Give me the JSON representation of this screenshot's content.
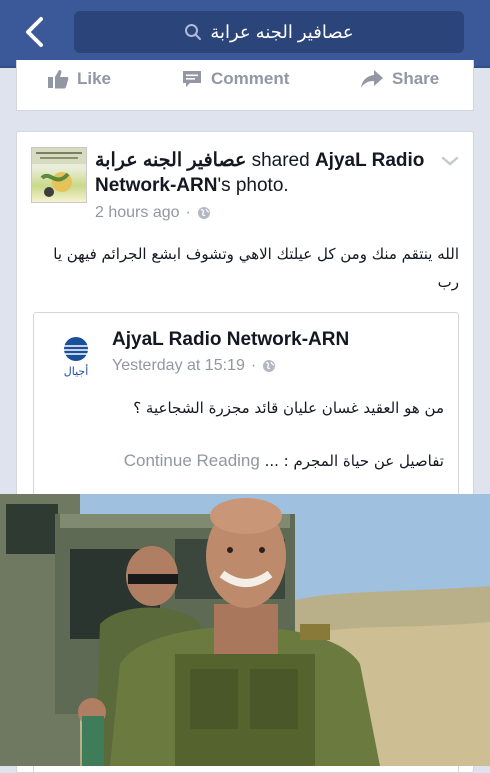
{
  "topbar": {
    "search_query": "عصافير الجنه عرابة"
  },
  "post_actions": {
    "like_label": "Like",
    "comment_label": "Comment",
    "share_label": "Share"
  },
  "post": {
    "page_name": "عصافير الجنه عرابة",
    "shared_text": " shared ",
    "shared_source": "AjyaL Radio Network-ARN",
    "photo_suffix": "'s photo.",
    "timestamp": "2 hours ago",
    "text": "الله ينتقم منك ومن كل عيلتك الاهي وتشوف ابشع الجرائم فيهن يا رب"
  },
  "shared_post": {
    "title": "AjyaL Radio Network-ARN",
    "timestamp": "Yesterday at 15:19",
    "logo_caption": "أجيال",
    "text": "من هو العقيد غسان عليان قائد مجزرة الشجاعية ؟",
    "teaser": "تفاصيل عن حياة المجرم : ...",
    "continue_label": "Continue Reading"
  },
  "colors": {
    "brand": "#3b5998",
    "search_bg": "#2b4479",
    "meta_text": "#9197a3",
    "page_bg": "#dfe3ee"
  },
  "icons": [
    "back-chevron-icon",
    "search-icon",
    "like-thumb-icon",
    "comment-bubble-icon",
    "share-arrow-icon",
    "globe-icon",
    "chevron-down-icon"
  ]
}
